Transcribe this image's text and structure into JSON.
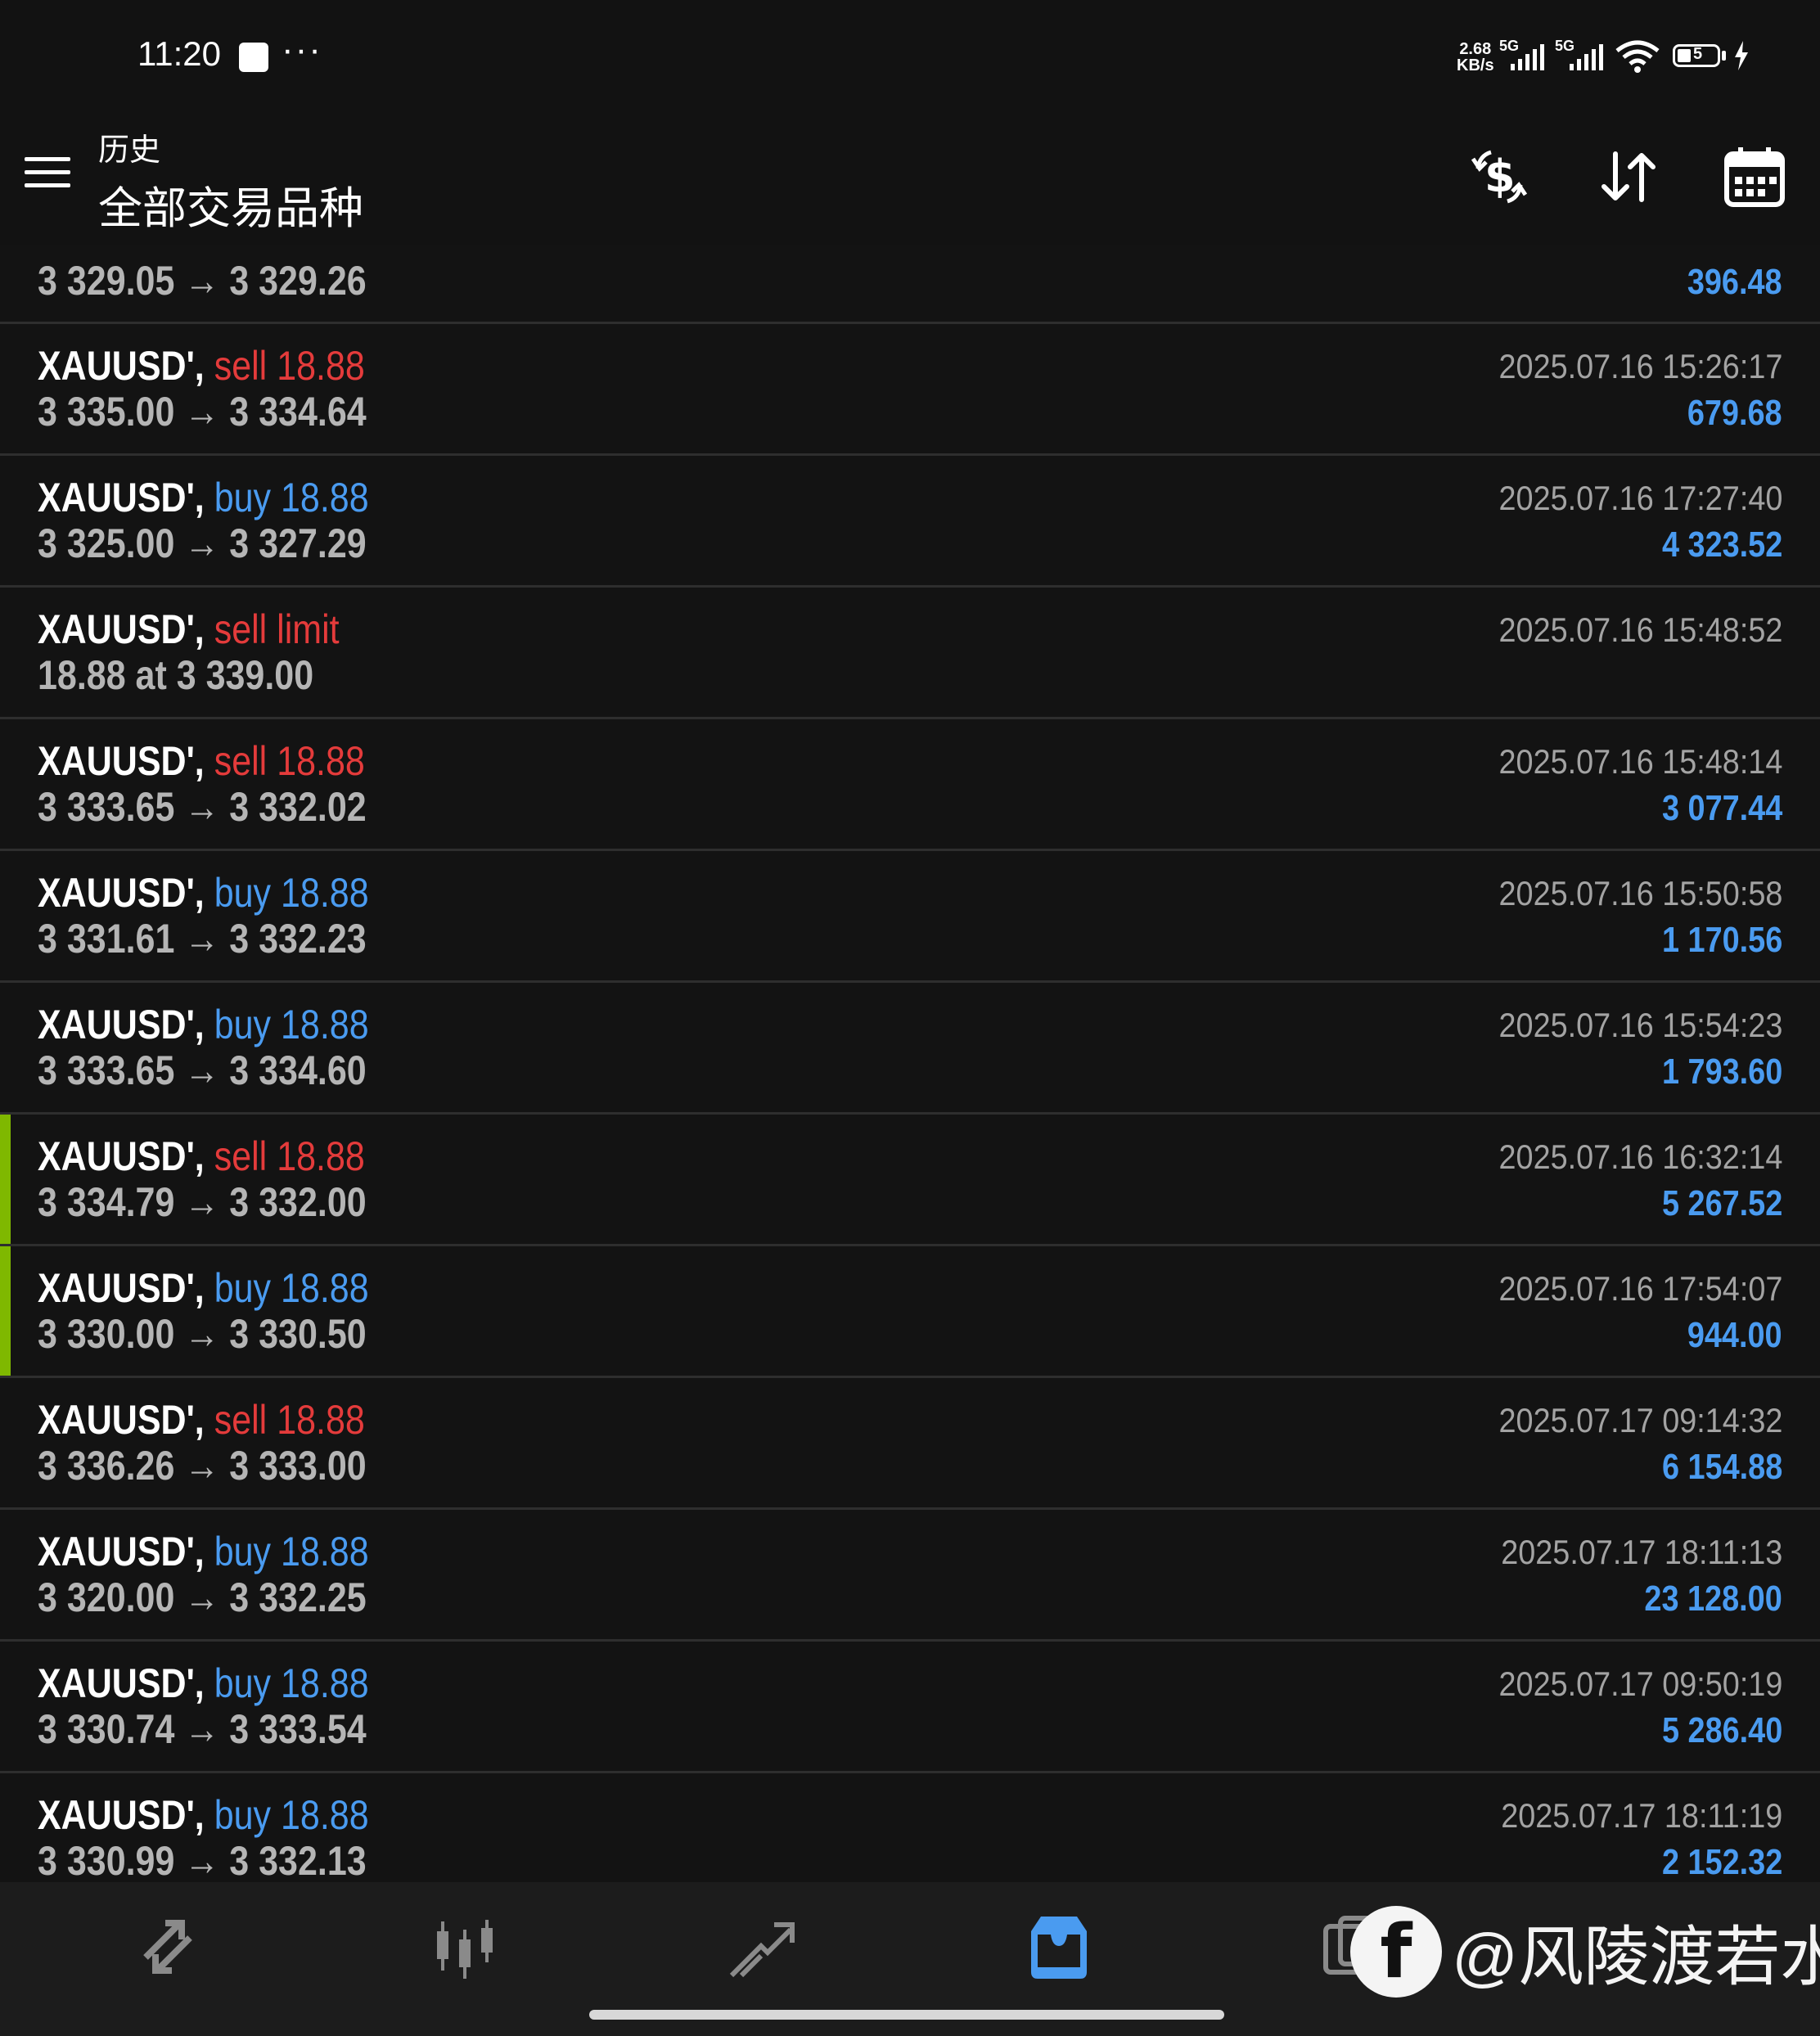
{
  "status": {
    "time": "11:20",
    "dots": "···",
    "speed_value": "2.68",
    "speed_unit": "KB/s",
    "net1": "5G",
    "net2": "5G",
    "battery": "5"
  },
  "header": {
    "subtitle": "历史",
    "title": "全部交易品种"
  },
  "partial_row": {
    "prices": "3 329.05 → 3 329.26",
    "profit": "396.48"
  },
  "trades": [
    {
      "symbol": "XAUUSD',",
      "side": "sell",
      "volume": "18.88",
      "prices": "3 335.00 → 3 334.64",
      "time": "2025.07.16 15:26:17",
      "profit": "679.68"
    },
    {
      "symbol": "XAUUSD',",
      "side": "buy",
      "volume": "18.88",
      "prices": "3 325.00 → 3 327.29",
      "time": "2025.07.16 17:27:40",
      "profit": "4 323.52"
    },
    {
      "symbol": "XAUUSD',",
      "side": "sell limit",
      "volume": "",
      "prices": "18.88 at 3 339.00",
      "time": "2025.07.16 15:48:52",
      "profit": ""
    },
    {
      "symbol": "XAUUSD',",
      "side": "sell",
      "volume": "18.88",
      "prices": "3 333.65 → 3 332.02",
      "time": "2025.07.16 15:48:14",
      "profit": "3 077.44"
    },
    {
      "symbol": "XAUUSD',",
      "side": "buy",
      "volume": "18.88",
      "prices": "3 331.61 → 3 332.23",
      "time": "2025.07.16 15:50:58",
      "profit": "1 170.56"
    },
    {
      "symbol": "XAUUSD',",
      "side": "buy",
      "volume": "18.88",
      "prices": "3 333.65 → 3 334.60",
      "time": "2025.07.16 15:54:23",
      "profit": "1 793.60"
    },
    {
      "symbol": "XAUUSD',",
      "side": "sell",
      "volume": "18.88",
      "prices": "3 334.79 → 3 332.00",
      "time": "2025.07.16 16:32:14",
      "profit": "5 267.52"
    },
    {
      "symbol": "XAUUSD',",
      "side": "buy",
      "volume": "18.88",
      "prices": "3 330.00 → 3 330.50",
      "time": "2025.07.16 17:54:07",
      "profit": "944.00"
    },
    {
      "symbol": "XAUUSD',",
      "side": "sell",
      "volume": "18.88",
      "prices": "3 336.26 → 3 333.00",
      "time": "2025.07.17 09:14:32",
      "profit": "6 154.88"
    },
    {
      "symbol": "XAUUSD',",
      "side": "buy",
      "volume": "18.88",
      "prices": "3 320.00 → 3 332.25",
      "time": "2025.07.17 18:11:13",
      "profit": "23 128.00"
    },
    {
      "symbol": "XAUUSD',",
      "side": "buy",
      "volume": "18.88",
      "prices": "3 330.74 → 3 333.54",
      "time": "2025.07.17 09:50:19",
      "profit": "5 286.40"
    },
    {
      "symbol": "XAUUSD',",
      "side": "buy",
      "volume": "18.88",
      "prices": "3 330.99 → 3 332.13",
      "time": "2025.07.17 18:11:19",
      "profit": "2 152.32"
    }
  ],
  "nav": {
    "items": [
      "quotes-icon",
      "chart-icon",
      "trade-icon",
      "history-icon",
      "messages-icon"
    ],
    "active": "history-icon"
  },
  "watermark": {
    "text": "@风陵渡若水"
  },
  "colors": {
    "sell": "#e43b3b",
    "buy": "#4a9bf0",
    "profit": "#4a9bf0",
    "marker": "#7fb800",
    "nav_active": "#4a9bf0"
  }
}
